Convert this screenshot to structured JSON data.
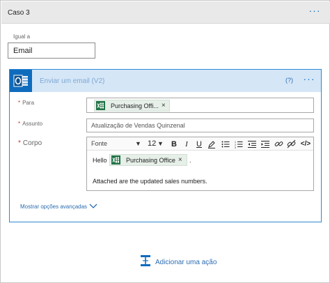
{
  "case": {
    "title": "Caso 3",
    "more": "···"
  },
  "condition": {
    "label": "Igual a",
    "value": "Email"
  },
  "action": {
    "title": "Enviar um email (V2)",
    "help": "(?)",
    "more": "···",
    "to_label": "Para",
    "to_token": "Purchasing Offi...",
    "subject_label": "Assunto",
    "subject_value": "Atualização de Vendas Quinzenal",
    "body_label": "Corpo",
    "toolbar": {
      "font": "Fonte",
      "size": "12",
      "bold": "B",
      "italic": "I",
      "underline": "U",
      "link": "</>"
    },
    "body_greeting": "Hello",
    "body_token": "Purchasing Office",
    "body_punct": ".",
    "body_line2": "Attached are the updated sales numbers.",
    "advanced_link": "Mostrar opções avançadas"
  },
  "add_action": {
    "label": "Adicionar uma ação"
  },
  "colors": {
    "accent": "#0f6cbd",
    "excel_green": "#217346",
    "token_bg": "#e6efe8"
  }
}
